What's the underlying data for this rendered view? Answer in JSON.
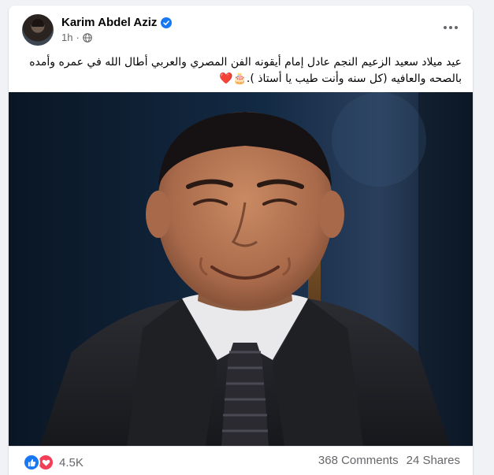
{
  "post": {
    "author_name": "Karim Abdel Aziz",
    "time": "1h",
    "privacy_icon": "globe-icon",
    "text": "عيد ميلاد سعيد الزعيم النجم عادل إمام أيقونه الفن المصري والعربي أطال الله في عمره وأمده بالصحه والعافيه (كل سنه وأنت طيب يا أستاذ ).🎂❤️",
    "verified_icon": "verified-badge-icon",
    "more_icon": "more-options-icon"
  },
  "footer": {
    "reaction_icons": [
      "like-icon",
      "love-icon"
    ],
    "reaction_count": "4.5K",
    "comments": "368 Comments",
    "shares": "24 Shares"
  },
  "colors": {
    "background": "#f0f2f5",
    "card": "#ffffff",
    "accent": "#1877f2",
    "love": "#f33e58",
    "muted_text": "#65676b"
  }
}
